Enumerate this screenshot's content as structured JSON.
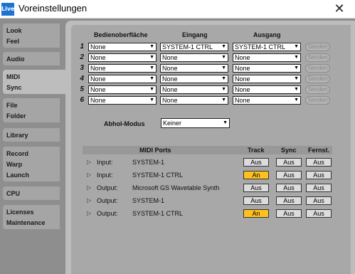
{
  "window": {
    "app_icon_text": "Live",
    "title": "Voreinstellungen",
    "close_glyph": "✕"
  },
  "sidebar": {
    "tabs": [
      {
        "lines": [
          "Look",
          "Feel"
        ]
      },
      {
        "lines": [
          "Audio"
        ]
      },
      {
        "lines": [
          "MIDI",
          "Sync"
        ],
        "active": true
      },
      {
        "lines": [
          "File",
          "Folder"
        ]
      },
      {
        "lines": [
          "Library"
        ]
      },
      {
        "lines": [
          "Record",
          "Warp",
          "Launch"
        ]
      },
      {
        "lines": [
          "CPU"
        ]
      },
      {
        "lines": [
          "Licenses",
          "Maintenance"
        ]
      }
    ]
  },
  "control_surfaces": {
    "col_surface": "Bedienoberfläche",
    "col_input": "Eingang",
    "col_output": "Ausgang",
    "rows": [
      {
        "num": "1",
        "surface": "None",
        "input": "SYSTEM-1 CTRL",
        "output": "SYSTEM-1 CTRL",
        "send": "Senden"
      },
      {
        "num": "2",
        "surface": "None",
        "input": "None",
        "output": "None",
        "send": "Senden"
      },
      {
        "num": "3",
        "surface": "None",
        "input": "None",
        "output": "None",
        "send": "Senden"
      },
      {
        "num": "4",
        "surface": "None",
        "input": "None",
        "output": "None",
        "send": "Senden"
      },
      {
        "num": "5",
        "surface": "None",
        "input": "None",
        "output": "None",
        "send": "Senden"
      },
      {
        "num": "6",
        "surface": "None",
        "input": "None",
        "output": "None",
        "send": "Senden"
      }
    ]
  },
  "takeover": {
    "label": "Abhol-Modus",
    "value": "Keiner"
  },
  "midi_ports": {
    "headers": {
      "ports": "MIDI Ports",
      "track": "Track",
      "sync": "Sync",
      "remote": "Fernst."
    },
    "rows": [
      {
        "type": "Input:",
        "name": "SYSTEM-1",
        "track": "Aus",
        "sync": "Aus",
        "remote": "Aus",
        "track_on": false
      },
      {
        "type": "Input:",
        "name": "SYSTEM-1 CTRL",
        "track": "An",
        "sync": "Aus",
        "remote": "Aus",
        "track_on": true
      },
      {
        "type": "Output:",
        "name": "Microsoft GS Wavetable Synth",
        "track": "Aus",
        "sync": "Aus",
        "remote": "Aus",
        "track_on": false
      },
      {
        "type": "Output:",
        "name": "SYSTEM-1",
        "track": "Aus",
        "sync": "Aus",
        "remote": "Aus",
        "track_on": false
      },
      {
        "type": "Output:",
        "name": "SYSTEM-1 CTRL",
        "track": "An",
        "sync": "Aus",
        "remote": "Aus",
        "track_on": true
      }
    ]
  },
  "colors": {
    "accent_on": "#ffc11e",
    "panel": "#bdbdbd",
    "inner": "#a8a8a8"
  }
}
